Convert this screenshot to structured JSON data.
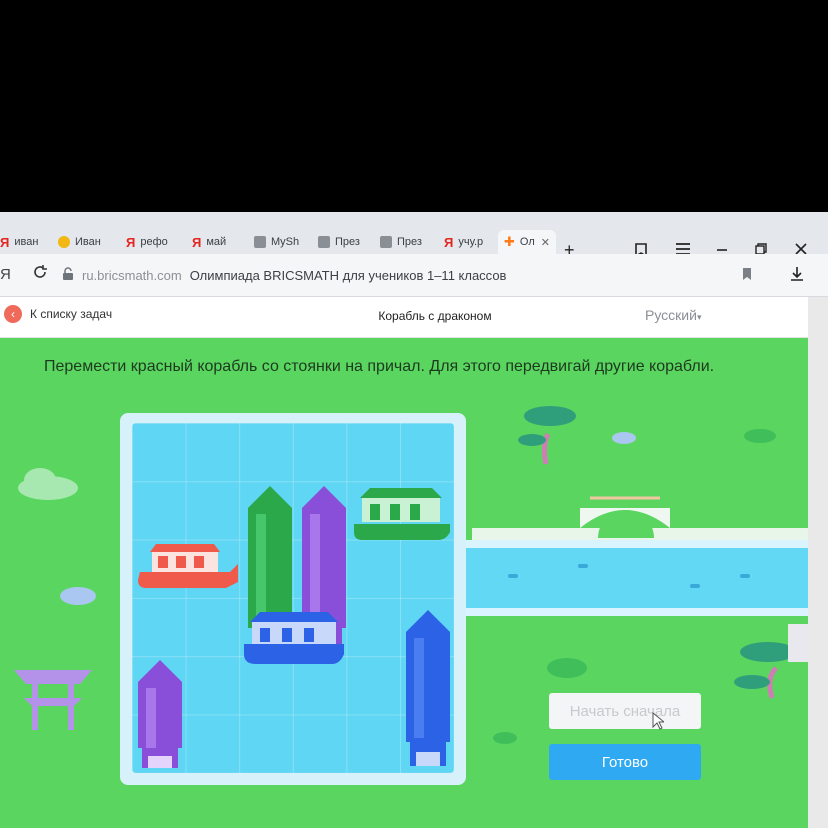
{
  "colors": {
    "grass": "#5ad660",
    "water": "#5fd6f3",
    "red_ship": "#ef5a4a",
    "green_ship": "#2aa84a",
    "purple_ship": "#8a4fd8",
    "blue_ship": "#2c62e6",
    "done_button": "#2fa9f1"
  },
  "browser": {
    "tabs": [
      {
        "label": "иван",
        "icon": "yandex-icon"
      },
      {
        "label": "Иван",
        "icon": "gold-circle-icon"
      },
      {
        "label": "рефо",
        "icon": "yandex-icon"
      },
      {
        "label": "май",
        "icon": "yandex-icon"
      },
      {
        "label": "MySh",
        "icon": "slides-icon"
      },
      {
        "label": "През",
        "icon": "slides-icon"
      },
      {
        "label": "През",
        "icon": "slides-icon"
      },
      {
        "label": "учу.р",
        "icon": "yandex-icon"
      },
      {
        "label": "Ол",
        "icon": "star-cross-icon"
      }
    ],
    "new_tab_symbol": "+",
    "address": {
      "domain": "ru.bricsmath.com",
      "title": "Олимпиада BRICSMATH для учеников 1–11 классов"
    }
  },
  "page": {
    "back_label": "К списку задач",
    "task_title": "Корабль с драконом",
    "language": "Русский"
  },
  "game": {
    "instruction": "Перемести красный корабль со стоянки на причал. Для этого передвигай другие корабли.",
    "restart_label": "Начать сначала",
    "done_label": "Готово"
  }
}
